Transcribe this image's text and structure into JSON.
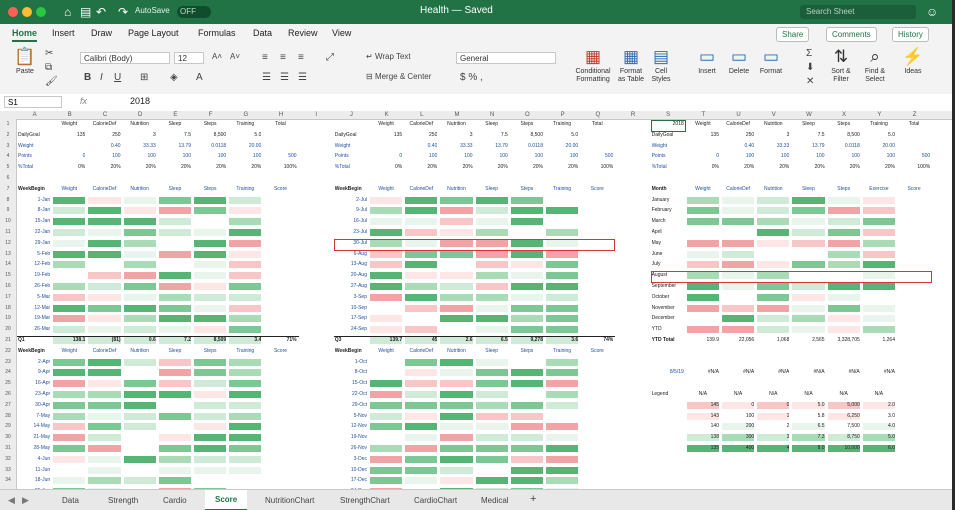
{
  "titlebar": {
    "autosave_label": "AutoSave",
    "autosave_state": "OFF",
    "document_title": "Health — Saved",
    "search_placeholder": "Search Sheet"
  },
  "menu": [
    "Home",
    "Insert",
    "Draw",
    "Page Layout",
    "Formulas",
    "Data",
    "Review",
    "View"
  ],
  "top_buttons": {
    "share": "Share",
    "comments": "Comments",
    "history": "History"
  },
  "ribbon": {
    "paste": "Paste",
    "font_name": "Calibri (Body)",
    "font_size": "12",
    "number_format": "General",
    "wrap_text": "Wrap Text",
    "merge_center": "Merge & Center",
    "percent": "$ % ,",
    "conditional_formatting": "Conditional Formatting",
    "format_as_table": "Format as Table",
    "cell_styles": "Cell Styles",
    "insert": "Insert",
    "delete": "Delete",
    "format": "Format",
    "sort_filter": "Sort & Filter",
    "find_select": "Find & Select",
    "ideas": "Ideas"
  },
  "formula_bar": {
    "cell_ref": "S1",
    "fx": "fx",
    "value": "2018"
  },
  "columns": [
    "A",
    "B",
    "C",
    "D",
    "E",
    "F",
    "G",
    "H",
    "I",
    "J",
    "K",
    "L",
    "M",
    "N",
    "O",
    "P",
    "Q",
    "R",
    "S",
    "T",
    "U",
    "V",
    "W",
    "X",
    "Y",
    "Z"
  ],
  "rows": [
    "1",
    "2",
    "3",
    "4",
    "5",
    "6",
    "7",
    "8",
    "9",
    "10",
    "11",
    "12",
    "13",
    "14",
    "15",
    "16",
    "17",
    "18",
    "19",
    "20",
    "21",
    "22",
    "23",
    "24",
    "25",
    "26",
    "27",
    "28",
    "29",
    "30",
    "31",
    "32",
    "33",
    "34"
  ],
  "header_labels": [
    "Weight",
    "CalorieDef",
    "Nutrition",
    "Sleep",
    "Steps",
    "Training",
    "Total"
  ],
  "side_labels": [
    "DailyGoal",
    "Weight",
    "Points",
    "%Total"
  ],
  "goal_values": [
    "135",
    "250",
    "3",
    "7.5",
    "8,500",
    "5.0"
  ],
  "weight_values": [
    "",
    "0.40",
    "33.33",
    "13.79",
    "0.0118",
    "20.00"
  ],
  "points_values": [
    "0",
    "100",
    "100",
    "100",
    "100",
    "100",
    "500"
  ],
  "pct_values": [
    "0%",
    "20%",
    "20%",
    "20%",
    "20%",
    "20%",
    "100%"
  ],
  "week_header": "WeekBegin",
  "week_cols": [
    "Weight",
    "CalorieDef",
    "Nutrition",
    "Sleep",
    "Steps",
    "Training",
    "Score"
  ],
  "q1": {
    "label": "Q1",
    "weeks": [
      "1-Jan",
      "8-Jan",
      "15-Jan",
      "22-Jan",
      "29-Jan",
      "5-Feb",
      "12-Feb",
      "19-Feb",
      "26-Feb",
      "5-Mar",
      "12-Mar",
      "19-Mar",
      "26-Mar"
    ],
    "total": [
      "138.1",
      "(81)",
      "0.6",
      "7.2",
      "8,509",
      "3.4",
      "71%"
    ]
  },
  "q2": {
    "label": "Q2",
    "weeks": [
      "2-Apr",
      "9-Apr",
      "16-Apr",
      "23-Apr",
      "30-Apr",
      "7-May",
      "14-May",
      "21-May",
      "28-May",
      "4-Jun",
      "11-Jun",
      "18-Jun",
      "25-Jun"
    ],
    "total": [
      "140.1",
      "175",
      "2.7",
      "7.2",
      "8,050",
      "3.4",
      "73%"
    ]
  },
  "q3": {
    "label": "Q3",
    "weeks": [
      "2-Jul",
      "9-Jul",
      "16-Jul",
      "23-Jul",
      "30-Jul",
      "6-Aug",
      "13-Aug",
      "20-Aug",
      "27-Aug",
      "3-Sep",
      "10-Sep",
      "17-Sep",
      "24-Sep"
    ],
    "total": [
      "139.7",
      "45",
      "2.6",
      "6.5",
      "9,278",
      "3.6",
      "74%"
    ]
  },
  "q4": {
    "label": "Q4",
    "weeks": [
      "1-Oct",
      "8-Oct",
      "15-Oct",
      "22-Oct",
      "29-Oct",
      "5-Nov",
      "12-Nov",
      "19-Nov",
      "26-Nov",
      "3-Dec",
      "10-Dec",
      "17-Dec",
      "24-Dec"
    ],
    "total": [
      "140.4",
      "87",
      "2.8",
      "7.0",
      "9,556",
      "3.6",
      "77%"
    ]
  },
  "month_table": {
    "header": "Month",
    "cols": [
      "Weight",
      "CalorieDef",
      "Nutrition",
      "Sleep",
      "Steps",
      "Exercise",
      "Score"
    ],
    "months": [
      "January",
      "February",
      "March",
      "April",
      "May",
      "June",
      "July",
      "August",
      "September",
      "October",
      "November",
      "December",
      "YTD"
    ],
    "ytd_total_label": "YTD Total",
    "ytd_total": [
      "139.9",
      "22,056",
      "1,068",
      "2,565",
      "3,328,705",
      "1,264"
    ]
  },
  "date_cell": "8/5/19",
  "na": "#N/A",
  "legend_label": "Legend",
  "legend_rows": [
    [
      "145",
      "0",
      "0",
      "5.0",
      "5,000",
      "2.0"
    ],
    [
      "143",
      "100",
      "1",
      "5.8",
      "6,250",
      "3.0"
    ],
    [
      "140",
      "200",
      "2",
      "6.5",
      "7,500",
      "4.0"
    ],
    [
      "138",
      "300",
      "3",
      "7.3",
      "8,750",
      "5.0"
    ],
    [
      "135",
      "400",
      "4",
      "8.0",
      "10,000",
      "6.0"
    ]
  ],
  "sheet_tabs": [
    "Data",
    "Strength",
    "Cardio",
    "Score",
    "NutritionChart",
    "StrengthChart",
    "CardioChart",
    "Medical"
  ],
  "active_tab": "Score",
  "colors": {
    "brand": "#217346",
    "green_hi": "#5cb87a",
    "red_hi": "#f4a7a9",
    "select": "#d9343a"
  }
}
